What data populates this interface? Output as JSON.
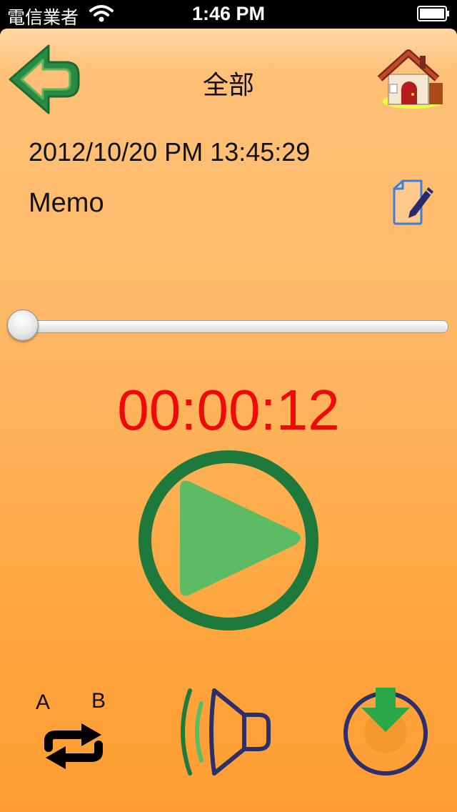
{
  "status_bar": {
    "carrier": "電信業者",
    "time": "1:46 PM"
  },
  "nav": {
    "title": "全部",
    "back_icon": "arrow-left-icon",
    "home_icon": "house-icon"
  },
  "record": {
    "datetime": "2012/10/20 PM 13:45:29",
    "memo": "Memo",
    "edit_icon": "document-pencil-icon"
  },
  "player": {
    "progress_fraction": 0.0,
    "elapsed": "00:00:12",
    "play_icon": "play-icon"
  },
  "controls": {
    "ab_repeat": {
      "label_a": "A",
      "label_b": "B",
      "icon": "repeat-icon"
    },
    "speaker_icon": "speaker-icon",
    "save_icon": "download-icon"
  },
  "colors": {
    "background_top": "#ffc27a",
    "background_bottom": "#ff9d33",
    "timer": "#ee0a0a",
    "accent_green": "#1e7a3c",
    "play_green": "#5dbb63",
    "navy": "#2b2f6b"
  }
}
